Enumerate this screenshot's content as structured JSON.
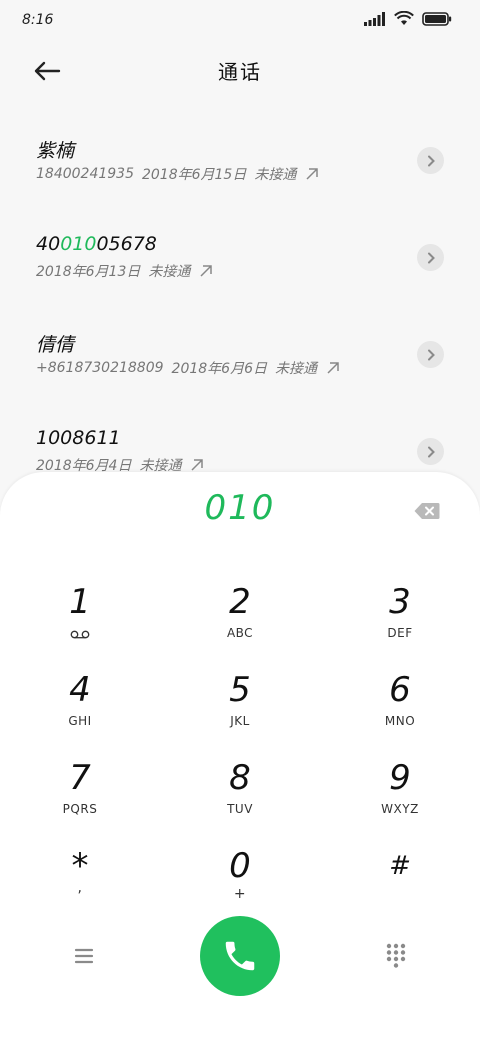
{
  "status_bar": {
    "time": "8:16"
  },
  "header": {
    "title": "通话"
  },
  "calls": [
    {
      "name": "紫楠",
      "name_parts": [
        "紫楠"
      ],
      "number": "18400241935",
      "date": "2018年6月15日",
      "status": "未接通"
    },
    {
      "name": "4001005678",
      "name_parts": [
        "40",
        "010",
        "05678"
      ],
      "number": "",
      "date": "2018年6月13日",
      "status": "未接通"
    },
    {
      "name": "倩倩",
      "name_parts": [
        "倩倩"
      ],
      "number": "+8618730218809",
      "date": "2018年6月6日",
      "status": "未接通"
    },
    {
      "name": "1008611",
      "name_parts": [
        "1008611"
      ],
      "number": "",
      "date": "2018年6月4日",
      "status": "未接通"
    }
  ],
  "dialer": {
    "input": "010",
    "keys": [
      {
        "digit": "1",
        "letters": ""
      },
      {
        "digit": "2",
        "letters": "ABC"
      },
      {
        "digit": "3",
        "letters": "DEF"
      },
      {
        "digit": "4",
        "letters": "GHI"
      },
      {
        "digit": "5",
        "letters": "JKL"
      },
      {
        "digit": "6",
        "letters": "MNO"
      },
      {
        "digit": "7",
        "letters": "PQRS"
      },
      {
        "digit": "8",
        "letters": "TUV"
      },
      {
        "digit": "9",
        "letters": "WXYZ"
      },
      {
        "digit": "*",
        "letters": ","
      },
      {
        "digit": "0",
        "letters": "+"
      },
      {
        "digit": "#",
        "letters": ""
      }
    ]
  },
  "colors": {
    "accent": "#1fb95b",
    "call_button": "#20c05e"
  },
  "icons": [
    "signal-icon",
    "wifi-icon",
    "battery-icon",
    "back-arrow-icon",
    "chevron-right-icon",
    "outgoing-call-icon",
    "backspace-icon",
    "voicemail-icon",
    "menu-icon",
    "phone-icon",
    "keypad-icon"
  ]
}
